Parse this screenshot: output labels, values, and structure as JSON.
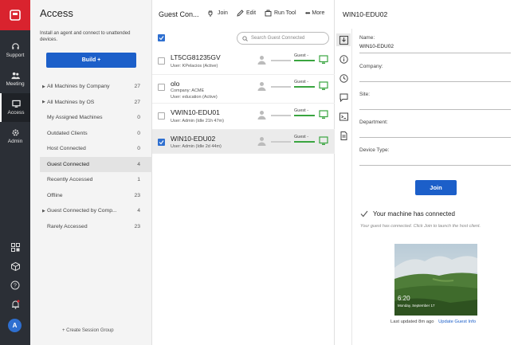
{
  "rail": {
    "items": [
      {
        "label": "Support",
        "icon": "headset-icon"
      },
      {
        "label": "Meeting",
        "icon": "people-icon"
      },
      {
        "label": "Access",
        "icon": "monitor-icon"
      },
      {
        "label": "Admin",
        "icon": "gear-icon"
      }
    ],
    "avatar": "A"
  },
  "access": {
    "title": "Access",
    "description": "Install an agent and connect to unattended devices.",
    "build_label": "Build +",
    "items": [
      {
        "label": "All Machines by Company",
        "count": "27"
      },
      {
        "label": "All Machines by OS",
        "count": "27"
      },
      {
        "label": "My Assigned Machines",
        "count": "0"
      },
      {
        "label": "Outdated Clients",
        "count": "0"
      },
      {
        "label": "Host Connected",
        "count": "0"
      },
      {
        "label": "Guest Connected",
        "count": "4"
      },
      {
        "label": "Recently Accessed",
        "count": "1"
      },
      {
        "label": "Offline",
        "count": "23"
      },
      {
        "label": "Guest Connected by Comp...",
        "count": "4"
      },
      {
        "label": "Rarely Accessed",
        "count": "23"
      }
    ],
    "create_label": "+ Create Session Group"
  },
  "list": {
    "title": "Guest Con...",
    "toolbar": {
      "join": "Join",
      "edit": "Edit",
      "run_tool": "Run Tool",
      "more": "More"
    },
    "search_placeholder": "Search Guest Connected",
    "rows": [
      {
        "name": "LT5CG81235GV",
        "line1": "User: KPelacios (Active)",
        "line2": "",
        "guest": "Guest -"
      },
      {
        "name": "olo",
        "line1": "Company: ACME",
        "line2": "User: education (Active)",
        "guest": "Guest -"
      },
      {
        "name": "VWIN10-EDU01",
        "line1": "User: Admin (Idle 21h 47m)",
        "line2": "",
        "guest": "Guest -"
      },
      {
        "name": "WIN10-EDU02",
        "line1": "User: Admin (Idle 2d 44m)",
        "line2": "",
        "guest": "Guest -"
      }
    ]
  },
  "detail": {
    "title": "WIN10-EDU02",
    "fields": [
      {
        "label": "Name:",
        "value": "WIN10-EDU02"
      },
      {
        "label": "Company:",
        "value": ""
      },
      {
        "label": "Site:",
        "value": ""
      },
      {
        "label": "Department:",
        "value": ""
      },
      {
        "label": "Device Type:",
        "value": ""
      }
    ],
    "join_label": "Join",
    "connected_text": "Your machine has connected",
    "hint": "Your guest has connected. Click Join to launch the host client.",
    "thumb_time": "6:20",
    "thumb_date": "Monday, September 17",
    "last_updated": "Last updated 8m ago",
    "update_link": "Update Guest Info"
  },
  "colors": {
    "accent": "#1c5fc9",
    "brand": "#d9232e",
    "rail": "#2b2f36",
    "online": "#3aa540"
  }
}
